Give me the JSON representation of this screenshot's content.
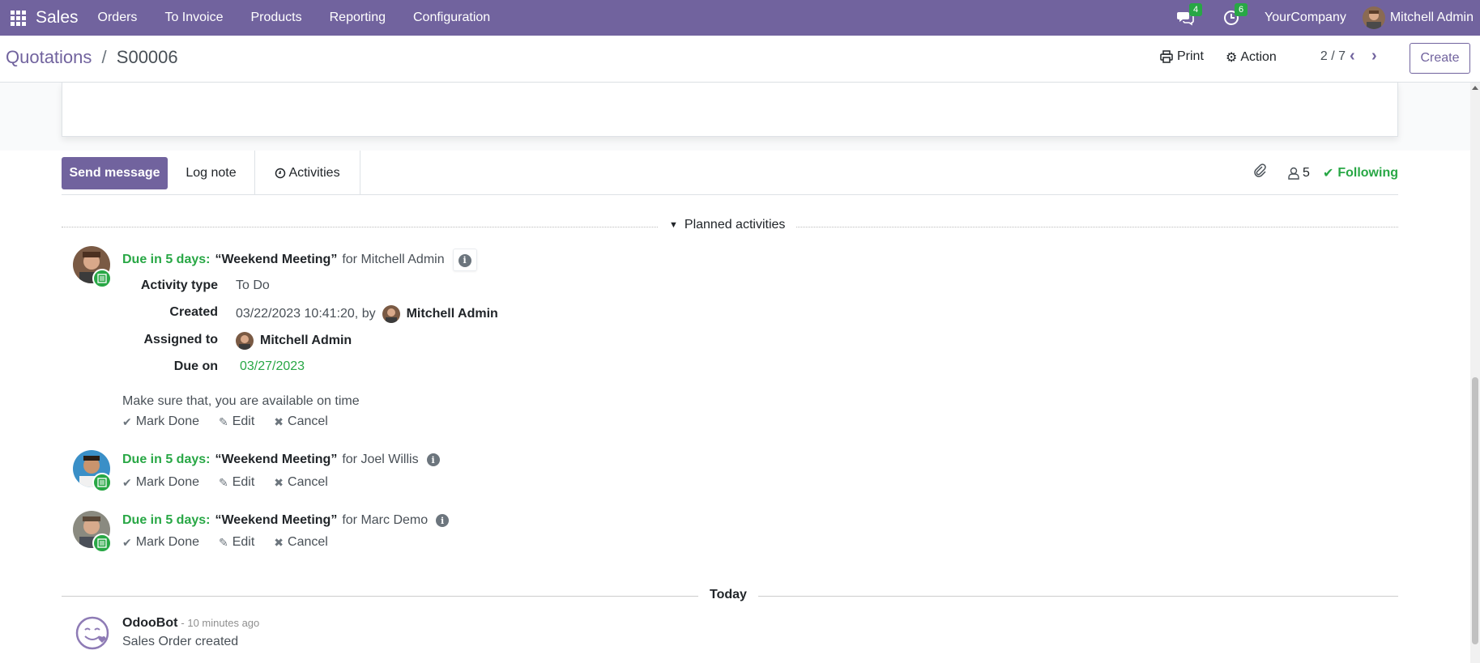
{
  "navbar": {
    "app_name": "Sales",
    "menu": [
      "Orders",
      "To Invoice",
      "Products",
      "Reporting",
      "Configuration"
    ],
    "messages_count": "4",
    "activities_count": "6",
    "company": "YourCompany",
    "user": "Mitchell Admin"
  },
  "control_panel": {
    "breadcrumb_parent": "Quotations",
    "breadcrumb_sep": "/",
    "breadcrumb_current": "S00006",
    "print_label": "Print",
    "action_label": "Action",
    "pager": "2 / 7",
    "create_label": "Create"
  },
  "chatter": {
    "send_message": "Send message",
    "log_note": "Log note",
    "activities": "Activities",
    "followers_count": "5",
    "following": "Following"
  },
  "planned": {
    "label": "Planned activities",
    "activities": [
      {
        "due": "Due in 5 days:",
        "summary": "“Weekend Meeting”",
        "for_user": "for Mitchell Admin",
        "details": {
          "activity_type_label": "Activity type",
          "activity_type": "To Do",
          "created_label": "Created",
          "created": "03/22/2023 10:41:20, by",
          "created_by": "Mitchell Admin",
          "assigned_label": "Assigned to",
          "assigned": "Mitchell Admin",
          "due_on_label": "Due on",
          "due_on": "03/27/2023"
        },
        "note": "Make sure that,  you are available on time"
      },
      {
        "due": "Due in 5 days:",
        "summary": "“Weekend Meeting”",
        "for_user": "for Joel Willis"
      },
      {
        "due": "Due in 5 days:",
        "summary": "“Weekend Meeting”",
        "for_user": "for Marc Demo"
      }
    ],
    "mark_done": "Mark Done",
    "edit": "Edit",
    "cancel": "Cancel"
  },
  "today_label": "Today",
  "message": {
    "author": "OdooBot",
    "date": "- 10 minutes ago",
    "body": "Sales Order created"
  },
  "colors": {
    "brand": "#71639e",
    "success": "#28a745"
  }
}
